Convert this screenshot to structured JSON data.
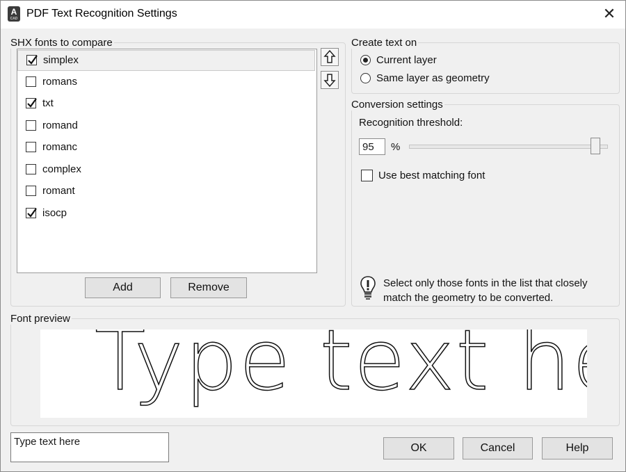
{
  "window": {
    "title": "PDF Text Recognition Settings",
    "close_symbol": "✕"
  },
  "fonts_group": {
    "legend": "SHX fonts to compare",
    "items": [
      {
        "label": "simplex",
        "checked": true,
        "selected": true
      },
      {
        "label": "romans",
        "checked": false,
        "selected": false
      },
      {
        "label": "txt",
        "checked": true,
        "selected": false
      },
      {
        "label": "romand",
        "checked": false,
        "selected": false
      },
      {
        "label": "romanc",
        "checked": false,
        "selected": false
      },
      {
        "label": "complex",
        "checked": false,
        "selected": false
      },
      {
        "label": "romant",
        "checked": false,
        "selected": false
      },
      {
        "label": "isocp",
        "checked": true,
        "selected": false
      }
    ],
    "add_label": "Add",
    "remove_label": "Remove"
  },
  "create_text_group": {
    "legend": "Create text on",
    "options": [
      {
        "label": "Current layer",
        "selected": true
      },
      {
        "label": "Same layer as geometry",
        "selected": false
      }
    ]
  },
  "conversion_group": {
    "legend": "Conversion settings",
    "threshold_label": "Recognition threshold:",
    "threshold_value": "95",
    "threshold_unit": "%",
    "threshold_slider_fraction": 0.95,
    "best_match_label": "Use best matching font",
    "best_match_checked": false,
    "tip": "Select only those fonts in the list that closely match the geometry to be converted."
  },
  "preview_group": {
    "legend": "Font preview",
    "preview_text": "Type text he"
  },
  "footer": {
    "sample_text": "Type text here",
    "ok_label": "OK",
    "cancel_label": "Cancel",
    "help_label": "Help"
  },
  "icons": {
    "app": "autocad-app-icon",
    "move_up": "arrow-up-icon",
    "move_down": "arrow-down-icon",
    "tip": "lightbulb-icon"
  }
}
